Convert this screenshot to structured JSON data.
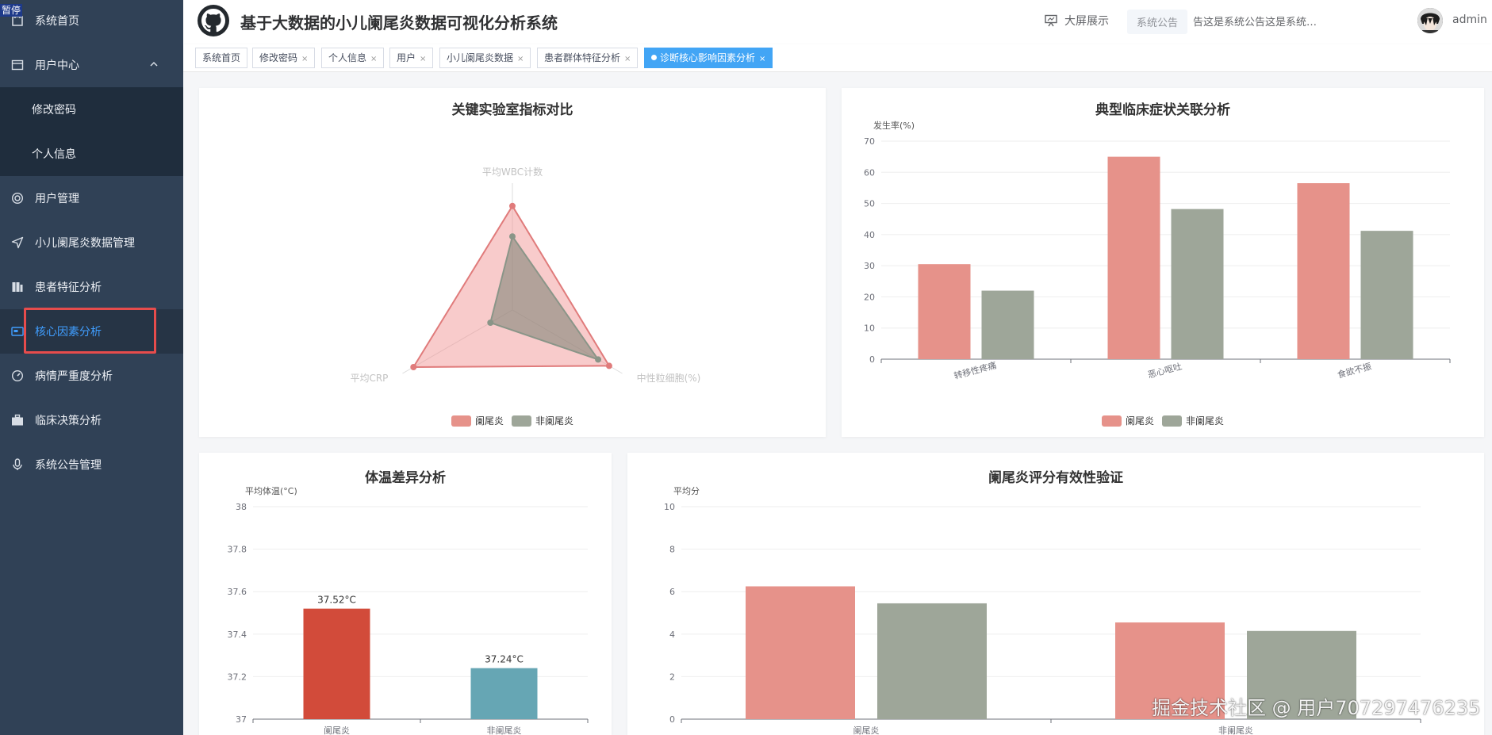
{
  "overlay": {
    "pause_label": "暂停",
    "watermark": "掘金技术社区 @ 用户707297476235"
  },
  "sidebar": {
    "items": [
      {
        "label": "系统首页",
        "icon": "home-icon"
      },
      {
        "label": "用户中心",
        "icon": "card-icon",
        "expanded": true
      },
      {
        "label": "修改密码",
        "sub": true
      },
      {
        "label": "个人信息",
        "sub": true
      },
      {
        "label": "用户管理",
        "icon": "lifebuoy-icon"
      },
      {
        "label": "小儿阑尾炎数据管理",
        "icon": "send-icon"
      },
      {
        "label": "患者特征分析",
        "icon": "columns-icon"
      },
      {
        "label": "核心因素分析",
        "icon": "monitor-icon",
        "active": true
      },
      {
        "label": "病情严重度分析",
        "icon": "gauge-icon"
      },
      {
        "label": "临床决策分析",
        "icon": "briefcase-icon"
      },
      {
        "label": "系统公告管理",
        "icon": "microphone-icon"
      }
    ]
  },
  "header": {
    "title": "基于大数据的小儿阑尾炎数据可视化分析系统",
    "big_screen": "大屏展示",
    "notice_label": "系统公告",
    "notice_text": "告这是系统公告这是系统…",
    "username": "admin"
  },
  "tags": [
    {
      "label": "系统首页",
      "closable": false
    },
    {
      "label": "修改密码",
      "closable": true
    },
    {
      "label": "个人信息",
      "closable": true
    },
    {
      "label": "用户",
      "closable": true
    },
    {
      "label": "小儿阑尾炎数据",
      "closable": true
    },
    {
      "label": "患者群体特征分析",
      "closable": true
    },
    {
      "label": "诊断核心影响因素分析",
      "closable": true,
      "active": true
    }
  ],
  "colors": {
    "appendicitis": "#e6928a",
    "non_appendicitis": "#9ea699",
    "temp_appendicitis": "#d24b3a",
    "temp_non": "#66a6b4",
    "radar_appendicitis": "#e07b7b",
    "radar_non": "#8a9588"
  },
  "chart_data": [
    {
      "id": "lab",
      "type": "radar",
      "title": "关键实验室指标对比",
      "indicators": [
        "平均WBC计数",
        "中性粒细胞(%)",
        "平均CRP"
      ],
      "series": [
        {
          "name": "阑尾炎",
          "values": [
            0.82,
            0.88,
            0.9
          ]
        },
        {
          "name": "非阑尾炎",
          "values": [
            0.58,
            0.78,
            0.2
          ]
        }
      ],
      "legend": [
        "阑尾炎",
        "非阑尾炎"
      ]
    },
    {
      "id": "symptom",
      "type": "bar",
      "title": "典型临床症状关联分析",
      "ylabel": "发生率(%)",
      "ylim": [
        0,
        70
      ],
      "yticks": [
        "0",
        "10",
        "20",
        "30",
        "40",
        "50",
        "60",
        "70"
      ],
      "categories": [
        "转移性疼痛",
        "恶心呕吐",
        "食欲不振"
      ],
      "series": [
        {
          "name": "阑尾炎",
          "values": [
            30.5,
            65.0,
            56.5
          ]
        },
        {
          "name": "非阑尾炎",
          "values": [
            22.0,
            48.2,
            41.2
          ]
        }
      ],
      "legend": [
        "阑尾炎",
        "非阑尾炎"
      ]
    },
    {
      "id": "temp",
      "type": "bar",
      "title": "体温差异分析",
      "ylabel": "平均体温(°C)",
      "ylim": [
        37,
        38
      ],
      "yticks": [
        "37",
        "37.2",
        "37.4",
        "37.6",
        "37.8",
        "38"
      ],
      "categories": [
        "阑尾炎",
        "非阑尾炎"
      ],
      "values": [
        37.52,
        37.24
      ],
      "labels": [
        "37.52°C",
        "37.24°C"
      ]
    },
    {
      "id": "score",
      "type": "bar",
      "title": "阑尾炎评分有效性验证",
      "ylabel": "平均分",
      "ylim": [
        0,
        10
      ],
      "yticks": [
        "0",
        "2",
        "4",
        "6",
        "8",
        "10"
      ],
      "categories": [
        "阑尾炎",
        "非阑尾炎"
      ],
      "series": [
        {
          "name": "",
          "values": [
            6.25,
            4.55
          ]
        },
        {
          "name": "",
          "values": [
            5.45,
            4.15
          ]
        }
      ]
    }
  ]
}
